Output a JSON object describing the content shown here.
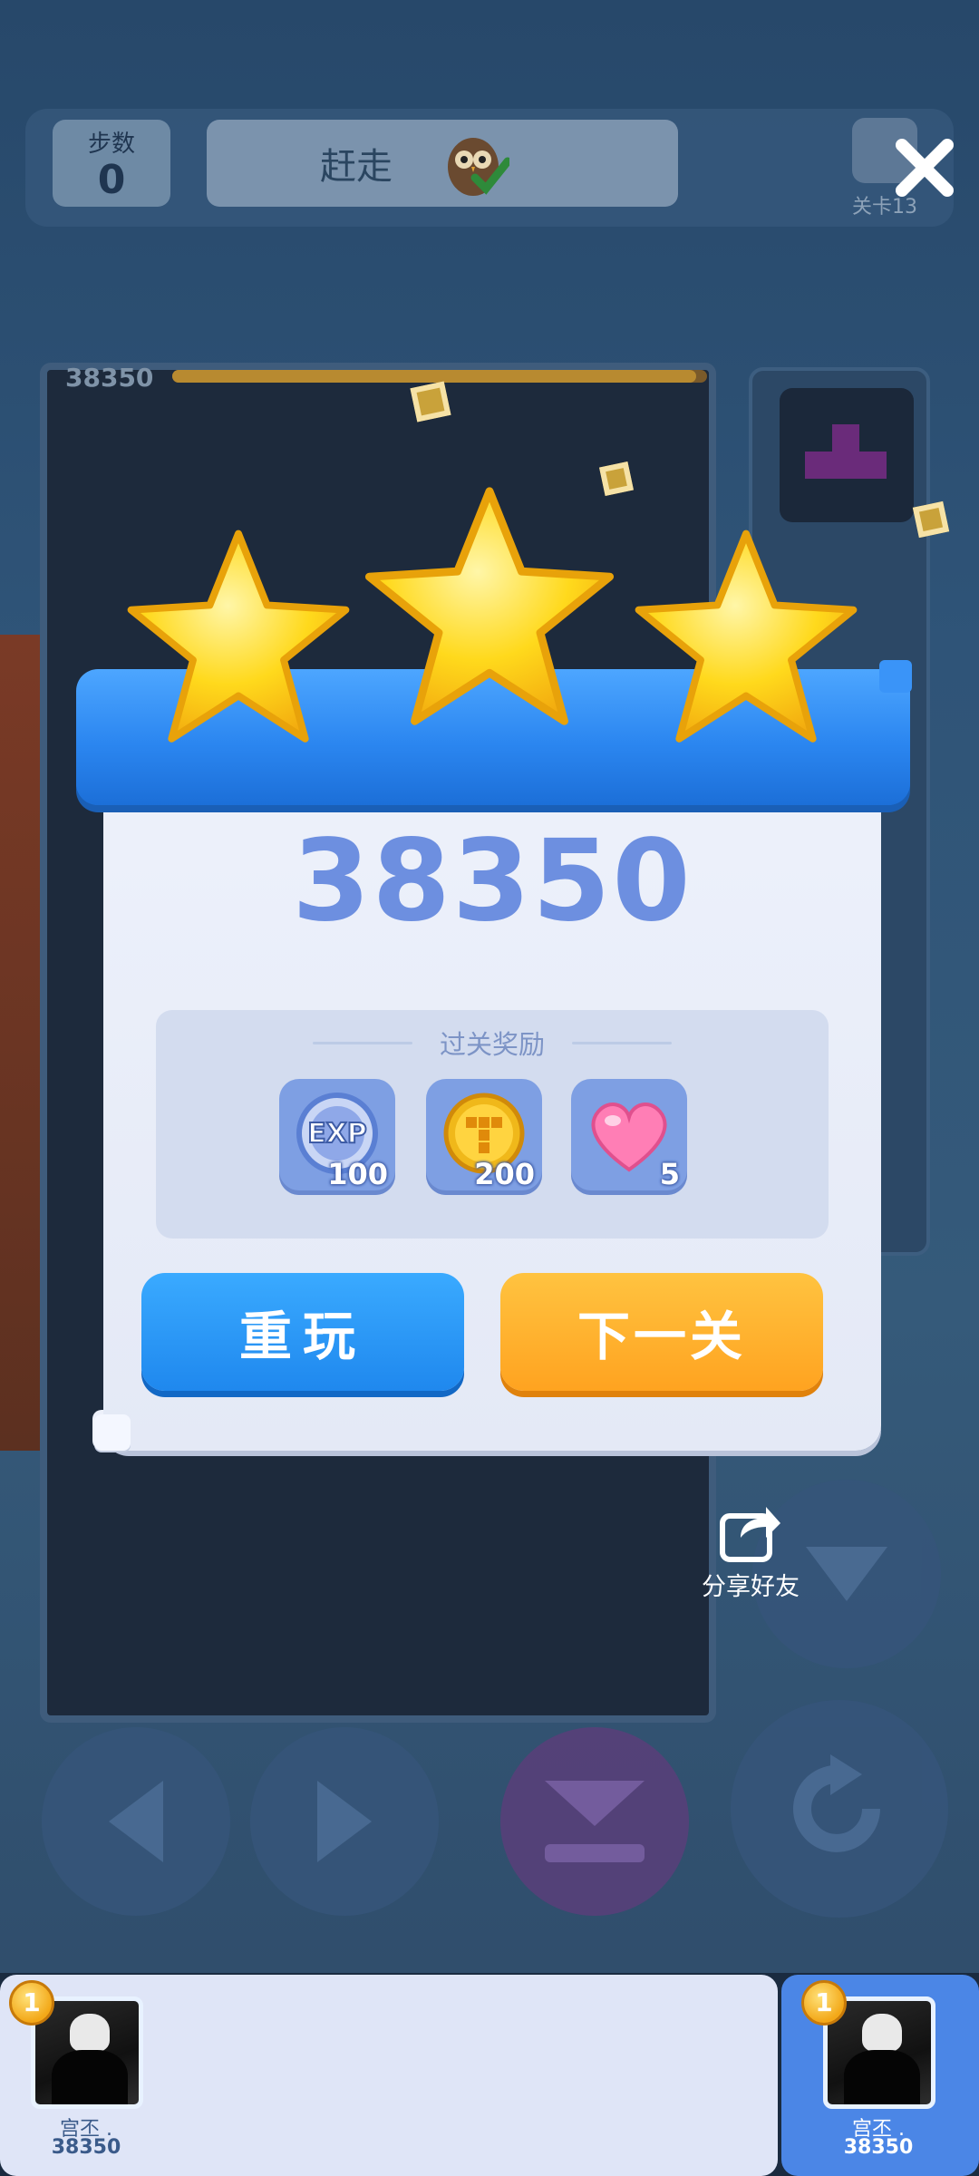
{
  "hud": {
    "steps_label": "步数",
    "steps_value": "0",
    "goal_label": "赶走",
    "level_label": "关卡13"
  },
  "board": {
    "score": "38350",
    "progress": 0.98
  },
  "result": {
    "stars_earned": 3,
    "stars_total": 3,
    "score": "38350",
    "rewards_title": "过关奖励",
    "rewards": [
      {
        "name": "exp-reward",
        "icon": "exp-icon",
        "count": "100"
      },
      {
        "name": "coin-reward",
        "icon": "coin-icon",
        "count": "200"
      },
      {
        "name": "heart-reward",
        "icon": "heart-icon",
        "count": "5"
      }
    ],
    "replay_label": "重玩",
    "next_label": "下一关"
  },
  "share": {
    "label": "分享好友",
    "icon": "share-icon"
  },
  "leaderboard": {
    "entries": [
      {
        "rank": "1",
        "name": "宫丕 .",
        "score": "38350"
      },
      {
        "rank": "1",
        "name": "宫丕 .",
        "score": "38350"
      }
    ]
  },
  "colors": {
    "score": "#6d8fe0",
    "replay_button": "#2a95f5",
    "next_button": "#ffb02c",
    "ribbon": "#2b86f0",
    "star": "#ffd21c"
  }
}
